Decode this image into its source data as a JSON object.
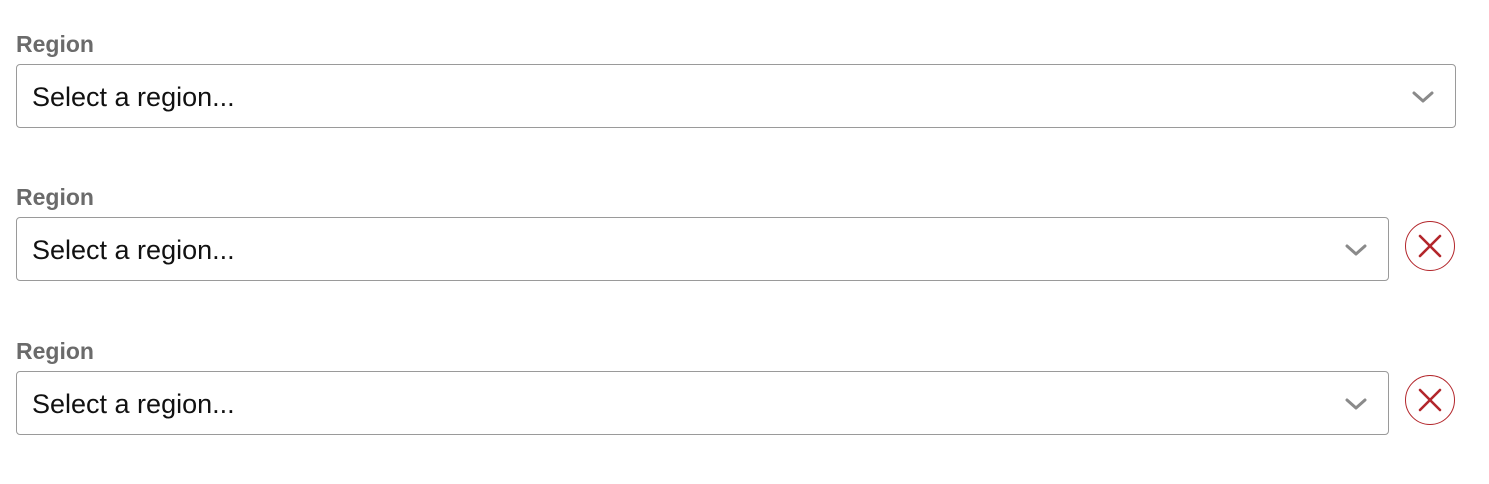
{
  "fields": [
    {
      "label": "Region",
      "placeholder": "Select a region...",
      "dropdown_icon": "chevron-down-icon",
      "removable": false
    },
    {
      "label": "Region",
      "placeholder": "Select a region...",
      "dropdown_icon": "chevron-down-icon",
      "removable": true,
      "remove_icon": "close-icon"
    },
    {
      "label": "Region",
      "placeholder": "Select a region...",
      "dropdown_icon": "chevron-down-icon",
      "removable": true,
      "remove_icon": "close-icon"
    }
  ],
  "colors": {
    "label": "#6b6b6b",
    "border": "#9a9a9a",
    "chevron": "#8a8a8a",
    "remove_accent": "#b3262b"
  }
}
